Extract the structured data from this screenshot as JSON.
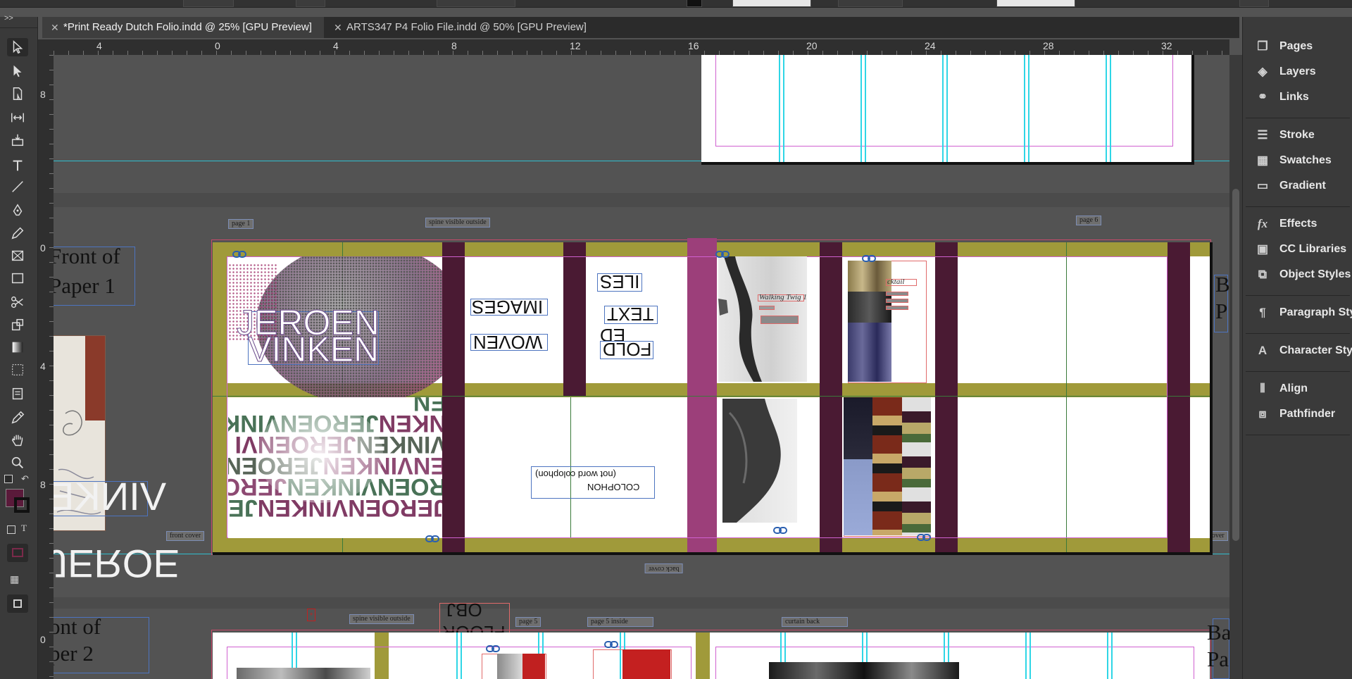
{
  "tabs": [
    {
      "label": "*Print Ready Dutch Folio.indd @ 25% [GPU Preview]",
      "active": true
    },
    {
      "label": "ARTS347 P4 Folio File.indd @ 50% [GPU Preview]",
      "active": false
    }
  ],
  "toolbox": {
    "expander": ">>"
  },
  "ruler": {
    "horizontal": [
      "4",
      "0",
      "4",
      "8",
      "12",
      "16",
      "20",
      "24",
      "28",
      "32"
    ],
    "vertical": [
      "8",
      "0",
      "4",
      "8",
      "0"
    ]
  },
  "panels": [
    {
      "label": "Pages",
      "icon": "pages-icon"
    },
    {
      "label": "Layers",
      "icon": "layers-icon"
    },
    {
      "label": "Links",
      "icon": "links-icon"
    },
    {
      "label": "Stroke",
      "icon": "stroke-icon"
    },
    {
      "label": "Swatches",
      "icon": "swatches-icon"
    },
    {
      "label": "Gradient",
      "icon": "gradient-icon"
    },
    {
      "label": "Effects",
      "icon": "effects-icon"
    },
    {
      "label": "CC Libraries",
      "icon": "cc-libraries-icon"
    },
    {
      "label": "Object Styles",
      "icon": "object-styles-icon"
    },
    {
      "label": "Paragraph Styles",
      "icon": "paragraph-styles-icon"
    },
    {
      "label": "Character Styles",
      "icon": "character-styles-icon"
    },
    {
      "label": "Align",
      "icon": "align-icon"
    },
    {
      "label": "Pathfinder",
      "icon": "pathfinder-icon"
    }
  ],
  "document": {
    "slugs": {
      "page1": "page 1",
      "spine_outside": "spine visible outside",
      "page6": "page 6",
      "front_cover": "front cover",
      "back_cover_right": "back cover",
      "back_cover_bottom": "back cover",
      "spine_outside_2": "spine visible outside",
      "page5": "page 5",
      "page5_inside": "page 5 inside",
      "curtain_back": "curtain back"
    },
    "texts": {
      "front_of_paper_1_line1": "Front of",
      "front_of_paper_1_line2": "Paper 1",
      "front_of_paper_2_line1": "ont of",
      "front_of_paper_2_line2": "per 2",
      "vinke": "VINKE",
      "jeroe": "JEROE",
      "jeroen": "JEROEN",
      "vinken": "VINKEN",
      "images": "IMAGES",
      "woven": "WOVEN",
      "iles": "ILES",
      "text": "TEXT",
      "ed": "ED",
      "fold": "FOLD",
      "walking_twig": "Walking Twig 1",
      "cocktail": "cktail",
      "colophon": "COLOPHON",
      "colophon_note": "(not word colophon)",
      "obj": "OBJ",
      "floor": "FLOOR",
      "back_b": "B",
      "back_p": "P",
      "back_ba": "Ba",
      "back_pa": "Pa"
    }
  }
}
